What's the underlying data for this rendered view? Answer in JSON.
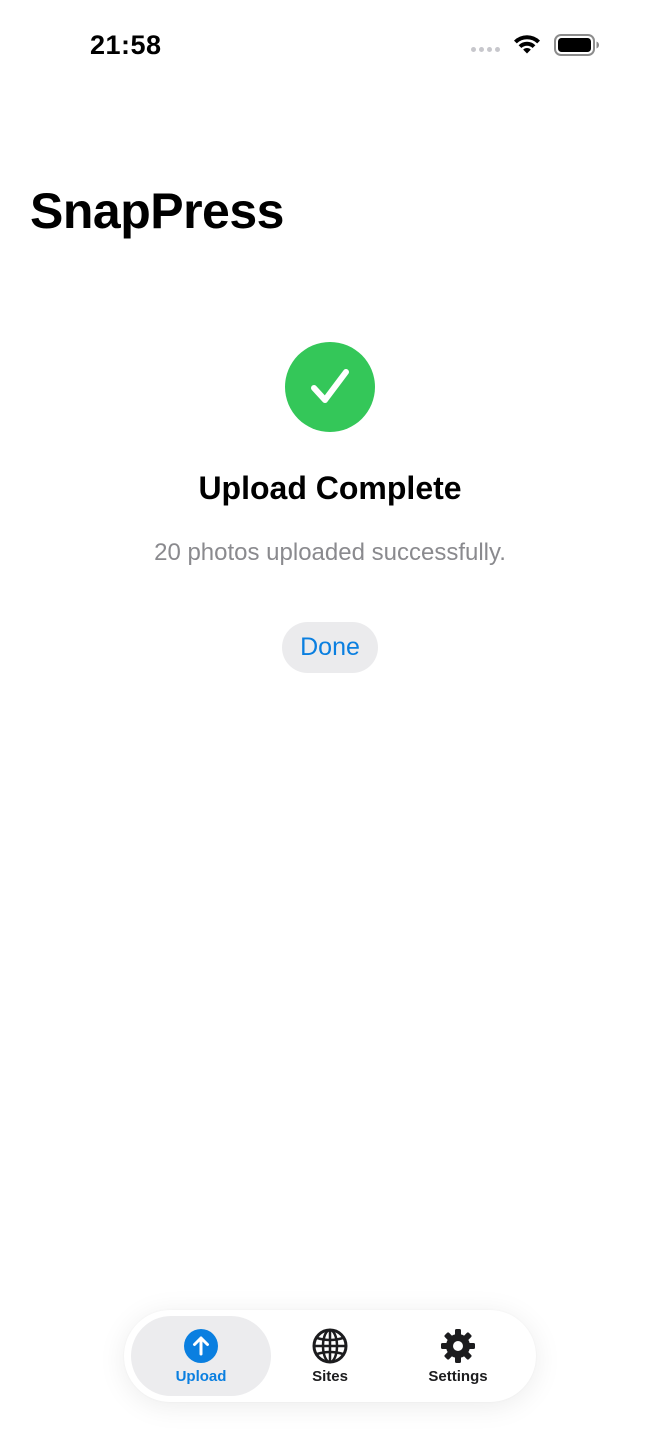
{
  "status_bar": {
    "time": "21:58"
  },
  "app": {
    "title": "SnapPress"
  },
  "upload_result": {
    "icon": "checkmark-circle-icon",
    "title": "Upload Complete",
    "message": "20 photos uploaded successfully.",
    "done_label": "Done"
  },
  "tab_bar": {
    "items": [
      {
        "label": "Upload",
        "icon": "arrow-up-circle-icon",
        "active": true
      },
      {
        "label": "Sites",
        "icon": "globe-icon",
        "active": false
      },
      {
        "label": "Settings",
        "icon": "gear-icon",
        "active": false
      }
    ]
  },
  "colors": {
    "accent": "#0a7fe0",
    "success": "#34c759",
    "secondary_text": "#8a8a8e"
  }
}
